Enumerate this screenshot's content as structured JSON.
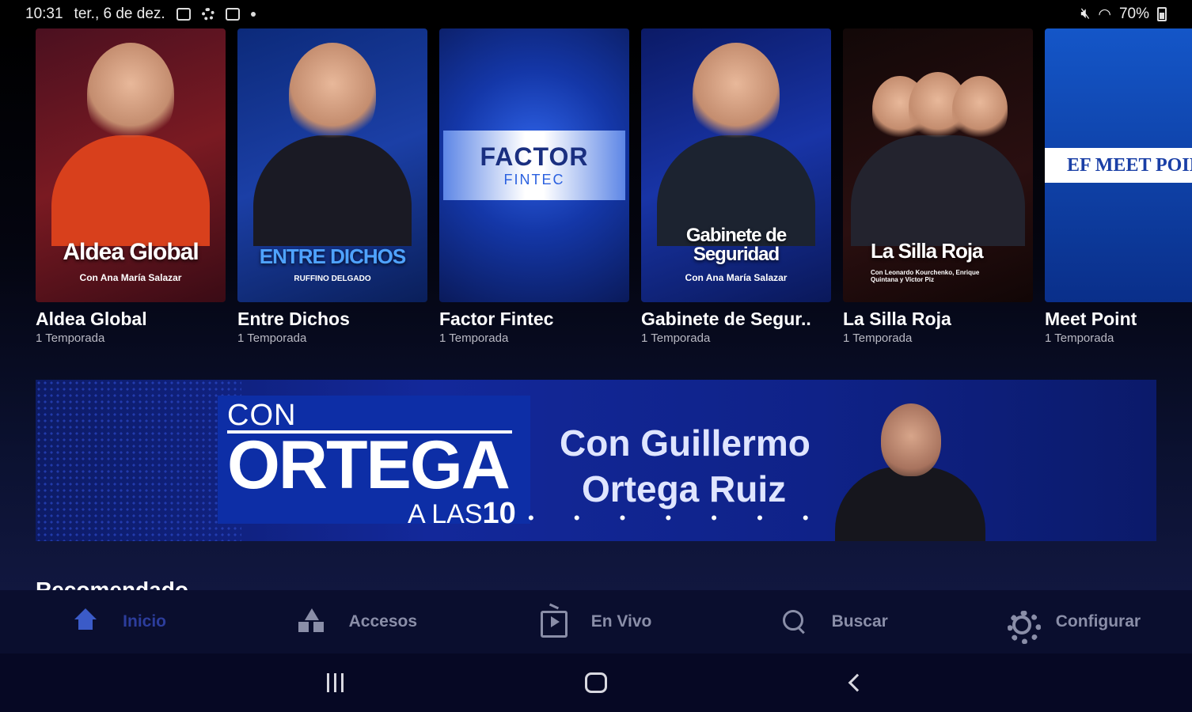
{
  "status_bar": {
    "time": "10:31",
    "date": "ter., 6 de dez.",
    "battery": "70%"
  },
  "shows": [
    {
      "title": "Aldea Global",
      "subtitle": "1 Temporada",
      "poster_text": "Aldea Global",
      "poster_sub": "Con Ana María Salazar"
    },
    {
      "title": "Entre Dichos",
      "subtitle": "1 Temporada",
      "poster_text": "ENTRE DICHOS",
      "poster_sub": "RUFFINO DELGADO"
    },
    {
      "title": "Factor Fintec",
      "subtitle": "1 Temporada",
      "poster_text": "FACTOR",
      "poster_sub": "FINTEC"
    },
    {
      "title": "Gabinete de Segur..",
      "subtitle": "1 Temporada",
      "poster_text": "Gabinete de Seguridad",
      "poster_sub": "Con Ana María Salazar"
    },
    {
      "title": "La Silla Roja",
      "subtitle": "1 Temporada",
      "poster_text": "La Silla Roja",
      "poster_sub": "Con Leonardo Kourchenko, Enrique Quintana y Víctor Piz"
    },
    {
      "title": "Meet Point",
      "subtitle": "1 Temporada",
      "poster_text": "EF MEET POINT"
    }
  ],
  "banner": {
    "logo_line1": "CON",
    "logo_line2": "ORTEGA",
    "logo_line3_prefix": "A LAS",
    "logo_line3_num": "10",
    "tagline_line1": "Con Guillermo",
    "tagline_line2": "Ortega Ruiz",
    "dots": "• • • • • • •"
  },
  "section_title": "Recomendado",
  "bottom_nav": [
    {
      "label": "Inicio",
      "icon": "home-icon",
      "active": true
    },
    {
      "label": "Accesos",
      "icon": "shapes-icon",
      "active": false
    },
    {
      "label": "En Vivo",
      "icon": "live-tv-icon",
      "active": false
    },
    {
      "label": "Buscar",
      "icon": "search-icon",
      "active": false
    },
    {
      "label": "Configurar",
      "icon": "gear-icon",
      "active": false
    }
  ],
  "colors": {
    "accent": "#2c3d9c",
    "nav_background": "#0a0e2e",
    "banner_blue": "#13289a"
  }
}
